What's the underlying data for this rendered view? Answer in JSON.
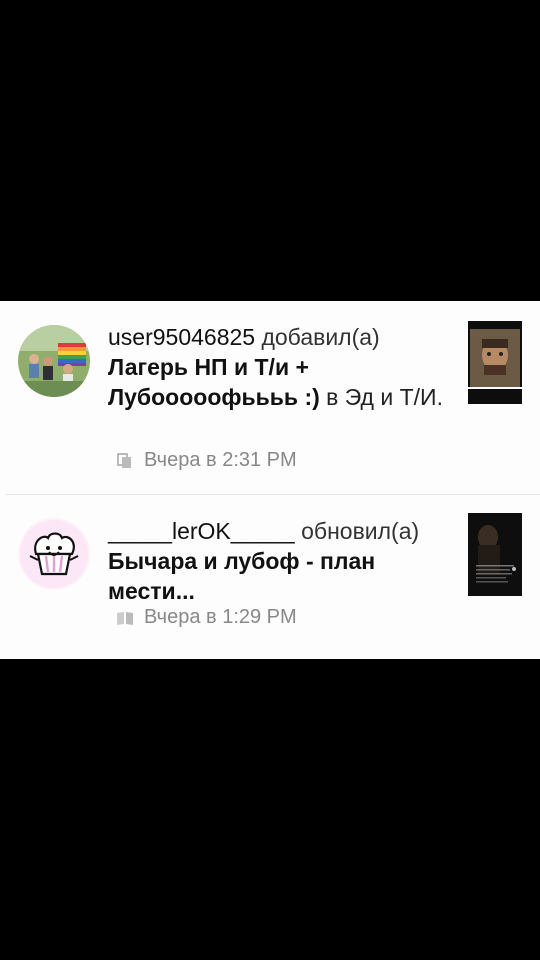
{
  "notifications": [
    {
      "username": "user95046825",
      "action": "добавил(а)",
      "title": "Лагерь НП и Т/и + Лубооооофьььь :)",
      "connector": "в",
      "target": "Эд и Т/И.",
      "time": "Вчера в 2:31 PM",
      "meta_icon": "copy-icon"
    },
    {
      "username": "_____lerOK_____",
      "action": "обновил(а)",
      "title": "Бычара и лубоф - план мести...",
      "time": "Вчера в 1:29 PM",
      "meta_icon": "book-icon"
    }
  ]
}
